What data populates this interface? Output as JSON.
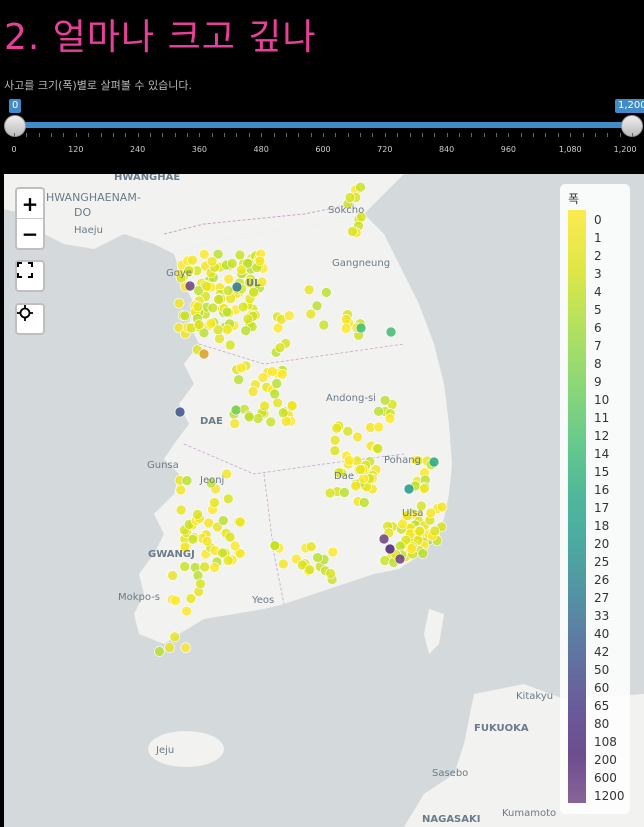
{
  "title": "2.  얼마나  크고  깊나",
  "subtitle": "사고를 크기(폭)별로 살펴볼 수 있습니다.",
  "slider": {
    "min_label": "0",
    "max_label": "1,200",
    "ticks": [
      "0",
      "120",
      "240",
      "360",
      "480",
      "600",
      "720",
      "840",
      "960",
      "1,080",
      "1,200"
    ]
  },
  "map": {
    "zoom_in": "+",
    "zoom_out": "−",
    "labels": {
      "hwanghae": "HWANGHAE",
      "hwanghaenam": "HWANGHAENAM-",
      "hwanghaenam2": "DO",
      "haeju": "Haeju",
      "goyang": "Goye",
      "seoul": "UL",
      "sokcho": "Sokcho",
      "gangneung": "Gangneung",
      "andong": "Andong-si",
      "daejeon": "DAE",
      "gunsan": "Gunsa",
      "jeonju": "Jeonj",
      "pohang": "Pohang",
      "daegu": "Dae",
      "ulsan": "Ulsa",
      "gwangju": "GWANGJ",
      "mokpo": "Mokpo-s",
      "yeosu": "Yeos",
      "jeju": "Jeju",
      "kitakyu": "Kitakyu",
      "fukuoka": "FUKUOKA",
      "sasebo": "Sasebo",
      "nagasaki": "NAGASAKI",
      "kumamoto": "Kumamoto"
    }
  },
  "legend": {
    "title": "폭",
    "items": [
      "0",
      "1",
      "2",
      "3",
      "4",
      "5",
      "6",
      "7",
      "8",
      "9",
      "10",
      "11",
      "12",
      "14",
      "15",
      "16",
      "17",
      "18",
      "20",
      "25",
      "26",
      "27",
      "33",
      "40",
      "42",
      "50",
      "60",
      "65",
      "80",
      "108",
      "200",
      "600",
      "1200"
    ]
  },
  "colors": {
    "title": "#e8409a",
    "slider": "#428bca",
    "sea": "#d4dadc",
    "land": "#f2f2f0"
  }
}
